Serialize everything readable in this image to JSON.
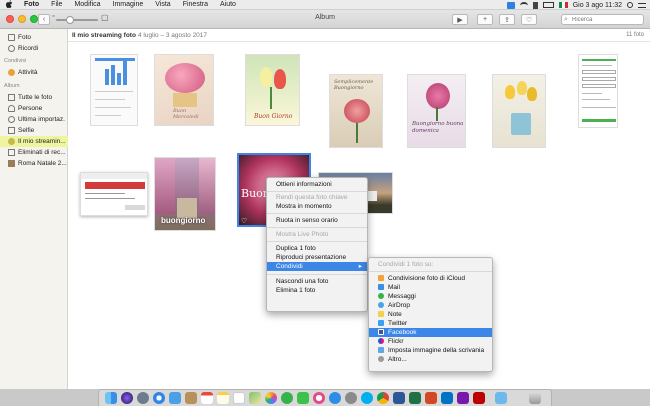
{
  "menubar": {
    "apple": "",
    "app_name": "Foto",
    "items": [
      "File",
      "Modifica",
      "Immagine",
      "Vista",
      "Finestra",
      "Aiuto"
    ],
    "clock": "Gio 3 ago  11:32"
  },
  "window": {
    "title": "Album"
  },
  "search": {
    "placeholder": "Ricerca"
  },
  "sidebar": {
    "items_top": [
      {
        "label": "Foto",
        "icon": "photo-library-icon"
      },
      {
        "label": "Ricordi",
        "icon": "memories-icon"
      }
    ],
    "shared_header": "Condivisi",
    "shared_items": [
      {
        "label": "Attività",
        "icon": "activity-icon"
      }
    ],
    "albums_header": "Album",
    "album_items": [
      {
        "label": "Tutte le foto",
        "icon": "all-photos-icon"
      },
      {
        "label": "Persone",
        "icon": "people-icon"
      },
      {
        "label": "Ultima importaz.",
        "icon": "last-import-icon"
      },
      {
        "label": "Selfie",
        "icon": "selfie-icon"
      },
      {
        "label": "Il mio streamin...",
        "icon": "photo-stream-icon"
      },
      {
        "label": "Eliminati di rec...",
        "icon": "trash-icon"
      },
      {
        "label": "Roma Natale 2...",
        "icon": "album-icon"
      }
    ],
    "selected_index": 4
  },
  "content": {
    "album_title": "Il mio streaming foto",
    "dates": "4 luglio – 3 agosto 2017",
    "photo_count": "11 foto",
    "photos": [
      {
        "id": "screenshot-chart",
        "text": ""
      },
      {
        "id": "roses-greeting",
        "text": "Buon Mercoledì"
      },
      {
        "id": "tulips-buon-giorno",
        "text": "Buon Giorno"
      },
      {
        "id": "flowers-semplicemente",
        "text": "Semplicemente Buongiorno"
      },
      {
        "id": "flowers-buongiorno-domenica",
        "text": "Buongiorno buona domenica"
      },
      {
        "id": "yellow-tulips",
        "text": ""
      },
      {
        "id": "screenshot-form",
        "text": ""
      },
      {
        "id": "screenshot-dialog",
        "text": ""
      },
      {
        "id": "street-buongiorno",
        "text": "buongiorno"
      },
      {
        "id": "pink-flower-selected",
        "text": "Buon"
      },
      {
        "id": "landscape-photo",
        "text": ""
      }
    ]
  },
  "context_menu": {
    "items": [
      {
        "label": "Ottieni informazioni",
        "disabled": false
      },
      {
        "sep": true
      },
      {
        "label": "Rendi questa foto chiave",
        "disabled": true
      },
      {
        "label": "Mostra in momento",
        "disabled": false
      },
      {
        "sep": true
      },
      {
        "label": "Ruota in senso orario",
        "disabled": false
      },
      {
        "sep": true
      },
      {
        "label": "Mostra Live Photo",
        "disabled": true
      },
      {
        "sep": true
      },
      {
        "label": "Duplica 1 foto",
        "disabled": false
      },
      {
        "label": "Riproduci presentazione",
        "disabled": false
      },
      {
        "label": "Condividi",
        "disabled": false,
        "highlight": true,
        "submenu": true
      },
      {
        "sep": true
      },
      {
        "label": "Nascondi una foto",
        "disabled": false
      },
      {
        "label": "Elimina 1 foto",
        "disabled": false
      }
    ]
  },
  "share_menu": {
    "header": "Condividi 1 foto su:",
    "items": [
      {
        "label": "Condivisione foto di iCloud",
        "icon": "icloud-photo-sharing-icon",
        "color": "#f2a33a"
      },
      {
        "label": "Mail",
        "icon": "mail-icon",
        "color": "#3a8ee6"
      },
      {
        "label": "Messaggi",
        "icon": "messages-icon",
        "color": "#35b34a"
      },
      {
        "label": "AirDrop",
        "icon": "airdrop-icon",
        "color": "#4aa3e8"
      },
      {
        "label": "Note",
        "icon": "notes-icon",
        "color": "#f5d04b"
      },
      {
        "label": "Twitter",
        "icon": "twitter-icon",
        "color": "#3aa1f2"
      },
      {
        "label": "Facebook",
        "icon": "facebook-icon",
        "color": "#3b5998",
        "highlight": true
      },
      {
        "label": "Flickr",
        "icon": "flickr-icon",
        "color": "#ff2e8b"
      },
      {
        "label": "Imposta immagine della scrivania",
        "icon": "desktop-picture-icon",
        "color": "#5fa8e8"
      },
      {
        "label": "Altro...",
        "icon": "more-icon",
        "color": "#9a9a9a"
      }
    ]
  },
  "dock": {
    "apps": [
      "finder-icon",
      "siri-icon",
      "launchpad-icon",
      "safari-icon",
      "mail-icon",
      "contacts-icon",
      "calendar-icon",
      "notes-icon",
      "reminders-icon",
      "maps-icon",
      "photos-icon",
      "messages-icon",
      "facetime-icon",
      "itunes-icon",
      "appstore-icon",
      "preferences-icon",
      "skype-icon",
      "chrome-icon",
      "word-icon",
      "excel-icon",
      "powerpoint-icon",
      "outlook-icon",
      "onenote-icon",
      "filezilla-icon",
      "folder-icon",
      "trash-icon"
    ]
  }
}
